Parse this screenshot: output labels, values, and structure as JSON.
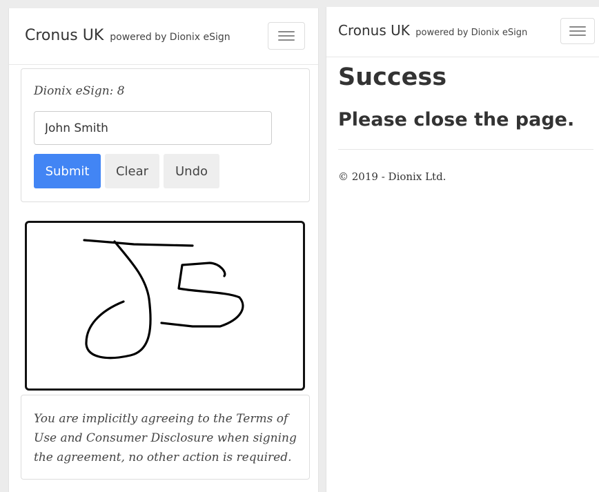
{
  "left_app": {
    "brand": "Cronus UK",
    "powered_by": "powered by Dionix eSign",
    "sign_form": {
      "title": "Dionix eSign: 8",
      "name_value": "John Smith",
      "submit_label": "Submit",
      "clear_label": "Clear",
      "undo_label": "Undo"
    },
    "signature_initials": "JS",
    "notice": "You are implicitly agreeing to the Terms of Use and Consumer Disclosure when signing the agreement, no other action is required."
  },
  "right_app": {
    "brand": "Cronus UK",
    "powered_by": "powered by Dionix eSign",
    "success_title": "Success",
    "close_message": "Please close the page.",
    "footer": "© 2019 - Dionix Ltd."
  },
  "colors": {
    "primary": "#4285f4",
    "secondary_button": "#eeeeee",
    "text": "#333333"
  },
  "icons": {
    "menu": "hamburger-menu-icon"
  }
}
